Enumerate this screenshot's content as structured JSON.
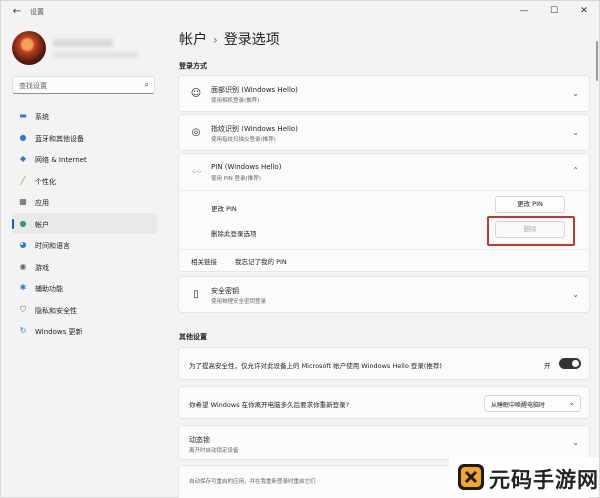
{
  "window": {
    "title": "设置",
    "controls": [
      "—",
      "☐",
      "✕"
    ]
  },
  "account": {
    "avatar": "avatar"
  },
  "search": {
    "placeholder": "查找设置"
  },
  "sidebar": {
    "items": [
      {
        "label": "系统",
        "icon": "monitor-icon",
        "active": false
      },
      {
        "label": "蓝牙和其他设备",
        "icon": "bluetooth-icon",
        "active": false
      },
      {
        "label": "网络 & Internet",
        "icon": "wifi-icon",
        "active": false
      },
      {
        "label": "个性化",
        "icon": "brush-icon",
        "active": false
      },
      {
        "label": "应用",
        "icon": "apps-icon",
        "active": false
      },
      {
        "label": "帐户",
        "icon": "person-icon",
        "active": true
      },
      {
        "label": "时间和语言",
        "icon": "globe-clock-icon",
        "active": false
      },
      {
        "label": "游戏",
        "icon": "gamepad-icon",
        "active": false
      },
      {
        "label": "辅助功能",
        "icon": "accessibility-icon",
        "active": false
      },
      {
        "label": "隐私和安全性",
        "icon": "shield-icon",
        "active": false
      },
      {
        "label": "Windows 更新",
        "icon": "update-icon",
        "active": false
      }
    ]
  },
  "breadcrumb": {
    "parent": "帐户",
    "separator": "›",
    "current": "登录选项"
  },
  "signin": {
    "heading": "登录方式",
    "face": {
      "title": "面部识别 (Windows Hello)",
      "subtitle": "使用相机登录(推荐)"
    },
    "fingerprint": {
      "title": "指纹识别 (Windows Hello)",
      "subtitle": "使用指纹扫描仪登录(推荐)"
    },
    "pin": {
      "title": "PIN (Windows Hello)",
      "subtitle": "使用 PIN 登录(推荐)",
      "change_label": "更改 PIN",
      "change_button": "更改 PIN",
      "remove_label": "删除此登录选项",
      "remove_button": "删除",
      "related_label": "相关链接",
      "forgot_link": "我忘记了我的 PIN"
    },
    "security_key": {
      "title": "安全密钥",
      "subtitle": "使用物理安全密钥登录"
    }
  },
  "other": {
    "heading": "其他设置",
    "hello_only": {
      "text": "为了提高安全性，仅允许对此设备上的 Microsoft 帐户使用 Windows Hello 登录(推荐)",
      "state": "开"
    },
    "away": {
      "text": "你希望 Windows 在你离开电脑多久后要求你重新登录?",
      "value": "从睡眠中唤醒电脑时"
    },
    "dynamic_lock": {
      "title": "动态锁",
      "subtitle": "离开时自动锁定设备"
    },
    "restart_apps": {
      "text": "自动保存可重启的应用，并在我重新登录时重启它们"
    }
  },
  "watermark": {
    "text": "元码手游网"
  }
}
